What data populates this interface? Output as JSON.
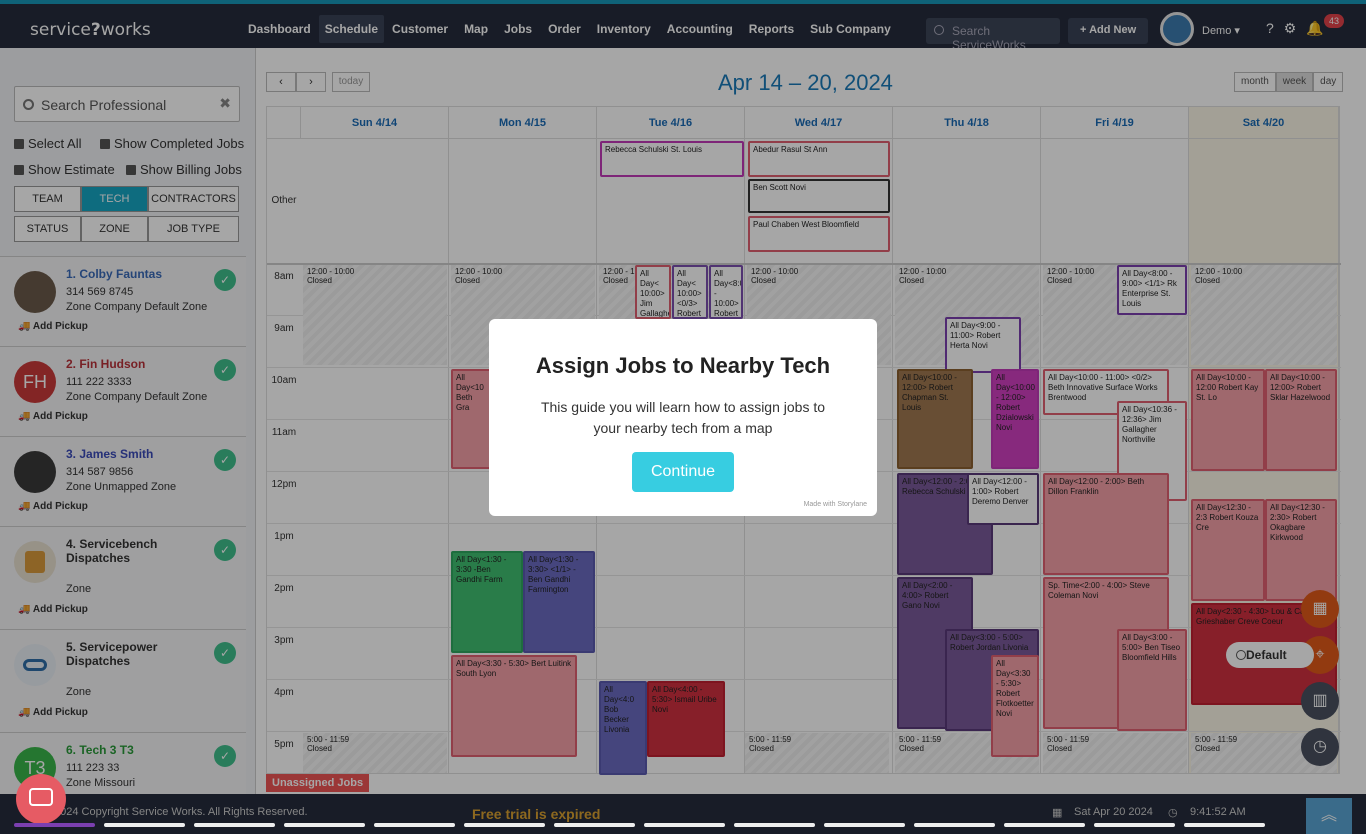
{
  "app": {
    "logo_a": "service",
    "logo_b": "works"
  },
  "nav": [
    "Dashboard",
    "Schedule",
    "Customer",
    "Map",
    "Jobs",
    "Order",
    "Inventory",
    "Accounting",
    "Reports",
    "Sub Company"
  ],
  "topbar": {
    "search_placeholder": "Search ServiceWorks",
    "add_new": "Add New",
    "user": "Demo",
    "notifications": "43"
  },
  "sidebar": {
    "search_placeholder": "Search Professional",
    "checks": [
      "Select All",
      "Show Completed Jobs",
      "Show Estimate",
      "Show Billing Jobs"
    ],
    "buttons": [
      "TEAM",
      "TECH",
      "CONTRACTORS",
      "STATUS",
      "ZONE",
      "JOB TYPE"
    ],
    "add_pickup": "Add Pickup",
    "pros": [
      {
        "name": "1. Colby Fauntas",
        "phone": "314 569 8745",
        "zone": "Zone Company Default Zone",
        "initials": "",
        "color": "#6b5a4a"
      },
      {
        "name": "2. Fin Hudson",
        "phone": "111 222 3333",
        "zone": "Zone Company Default Zone",
        "initials": "FH",
        "color": "#c93a3a"
      },
      {
        "name": "3. James Smith",
        "phone": "314 587 9856",
        "zone": "Zone Unmapped Zone",
        "initials": "",
        "color": "#3a3a3a"
      },
      {
        "name": "4. Servicebench Dispatches",
        "phone": "",
        "zone": "Zone",
        "initials": "",
        "color": "#d99a3b"
      },
      {
        "name": "5. Servicepower Dispatches",
        "phone": "",
        "zone": "Zone",
        "initials": "",
        "color": "#2e6ea8"
      },
      {
        "name": "6. Tech 3 T3",
        "phone": "111 223 33",
        "zone": "Zone Missouri",
        "initials": "T3",
        "color": "#3ab54a"
      }
    ]
  },
  "calendar": {
    "title": "Apr 14 – 20, 2024",
    "today": "today",
    "views": [
      "month",
      "week",
      "day"
    ],
    "days": [
      "Sun 4/14",
      "Mon 4/15",
      "Tue 4/16",
      "Wed 4/17",
      "Thu 4/18",
      "Fri 4/19",
      "Sat 4/20"
    ],
    "times": [
      "Other",
      "8am",
      "9am",
      "10am",
      "11am",
      "12pm",
      "1pm",
      "2pm",
      "3pm",
      "4pm",
      "5pm"
    ],
    "closed_am": "12:00 - 10:00",
    "closed_pm": "5:00 - 11:59",
    "closed": "Closed",
    "unassigned": "Unassigned Jobs",
    "events": {
      "rebecca": "Rebecca Schulski St. Louis",
      "abedur": "Abedur Rasul St Ann",
      "benscott": "Ben Scott Novi",
      "paul": "Paul Chaben West Bloomfield",
      "herta": "All Day<9:00 - 11:00> Robert Herta Novi",
      "rk": "All Day<8:00 - 9:00> <1/1> Rk Enterprise St. Louis",
      "kay": "All Day<10:00 - 12:00 Robert Kay St. Lo",
      "sklar": "All Day<10:00 - 12:00> Robert Sklar Hazelwood",
      "innov": "All Day<10:00 - 11:00> <0/2> Beth Innovative Surface Works Brentwood",
      "gallagher": "All Day<10:36 - 12:36> Jim Gallagher Northville",
      "chapman": "All Day<10:00 - 12:00> Robert Chapman St. Louis",
      "dzial": "All Day<10:00 - 12:00> Robert Dzialowski Novi",
      "dillon": "All Day<12:00 - 2:00> Beth Dillon Franklin",
      "rschulski": "All Day<12:00 - 2:00 Rebecca Schulski",
      "deremo": "All Day<12:00 - 1:00> Robert Deremo Denver",
      "kouza": "All Day<12:30 - 2:3 Robert Kouza Cre",
      "okagbare": "All Day<12:30 - 2:30> Robert Okagbare Kirkwood",
      "gano": "All Day<2:00 - 4:00> Robert Gano Novi",
      "coleman": "Sp. Time<2:00 - 4:00> Steve Coleman Novi",
      "grieshaber": "All Day<2:30 - 4:30> Lou & Cathy Grieshaber Creve Coeur",
      "jordan": "All Day<3:00 - 5:00> Robert Jordan Livonia",
      "flotkoetter": "All Day<3:30 - 5:30> Robert Flotkoetter Novi",
      "tiseo": "All Day<3:00 - 5:00> Ben Tiseo Bloomfield Hills",
      "gandhi": "All Day<1:30 - 3:30 -Ben Gandhi Farm",
      "gandhi2": "All Day<1:30 - 3:30> <1/1> -Ben Gandhi Farmington",
      "luitink": "All Day<3:30 - 5:30> Bert Luitink South Lyon",
      "becker": "All Day<4:0 Bob Becker Livonia",
      "uribe": "All Day<4:00 - 5:30> Ismail Uribe Novi",
      "begrah": "All Day<10 Beth Gra",
      "jim": "All Day< 10:00> Jim Gallaghe Northvill",
      "krajicek": "All Day< 10:00> <0/3> Robert Krajicek",
      "baker": "All Day<8:0 - 10:00> Robert Baker"
    }
  },
  "modal": {
    "title": "Assign Jobs to Nearby Tech",
    "body": "This guide you will learn how to assign jobs to your nearby tech from a map",
    "button": "Continue",
    "made_with": "Made with Storylane"
  },
  "fab": {
    "default": "Default"
  },
  "footer": {
    "copyright": "2024 Copyright Service Works. All Rights Reserved.",
    "trial": "Free trial is expired",
    "date": "Sat Apr 20 2024",
    "time": "9:41:52 AM"
  },
  "progress": {
    "total_steps": 14,
    "current_step": 1
  }
}
